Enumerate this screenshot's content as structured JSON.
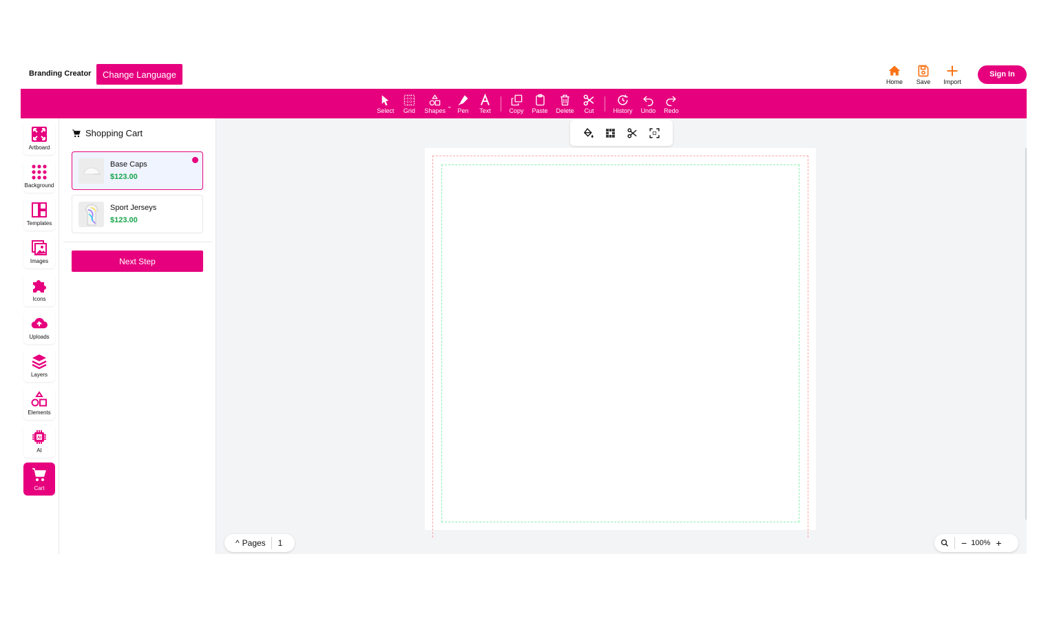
{
  "header": {
    "brand": "Branding Creator",
    "language_button": "Change Language",
    "actions": [
      {
        "label": "Home",
        "icon": "home-icon"
      },
      {
        "label": "Save",
        "icon": "save-icon"
      },
      {
        "label": "Import",
        "icon": "plus-icon"
      }
    ],
    "signin": "Sign In"
  },
  "toolbar": {
    "select": "Select",
    "grid": "Grid",
    "shapes": "Shapes",
    "pen": "Pen",
    "text": "Text",
    "copy": "Copy",
    "paste": "Paste",
    "delete": "Delete",
    "cut": "Cut",
    "history": "History",
    "undo": "Undo",
    "redo": "Redo"
  },
  "sidebar": {
    "items": [
      {
        "label": "Artboard",
        "icon": "artboard-icon"
      },
      {
        "label": "Background",
        "icon": "dots-grid-icon"
      },
      {
        "label": "Templates",
        "icon": "templates-icon"
      },
      {
        "label": "Images",
        "icon": "images-icon"
      },
      {
        "label": "Icons",
        "icon": "puzzle-icon"
      },
      {
        "label": "Uploads",
        "icon": "cloud-upload-icon"
      },
      {
        "label": "Layers",
        "icon": "layers-icon"
      },
      {
        "label": "Elements",
        "icon": "shapes-icon"
      },
      {
        "label": "AI",
        "icon": "chip-icon"
      },
      {
        "label": "Cart",
        "icon": "cart-icon",
        "active": true
      }
    ]
  },
  "cart": {
    "title": "Shopping Cart",
    "items": [
      {
        "name": "Base Caps",
        "price": "$123.00",
        "selected": true
      },
      {
        "name": "Sport Jerseys",
        "price": "$123.00",
        "selected": false
      }
    ],
    "next_button": "Next Step"
  },
  "footer": {
    "pages_label": "Pages",
    "page_number": "1",
    "zoom": "100%"
  },
  "colors": {
    "brand": "#e6007e",
    "price": "#16a34a",
    "header_icons": "#f97316"
  }
}
